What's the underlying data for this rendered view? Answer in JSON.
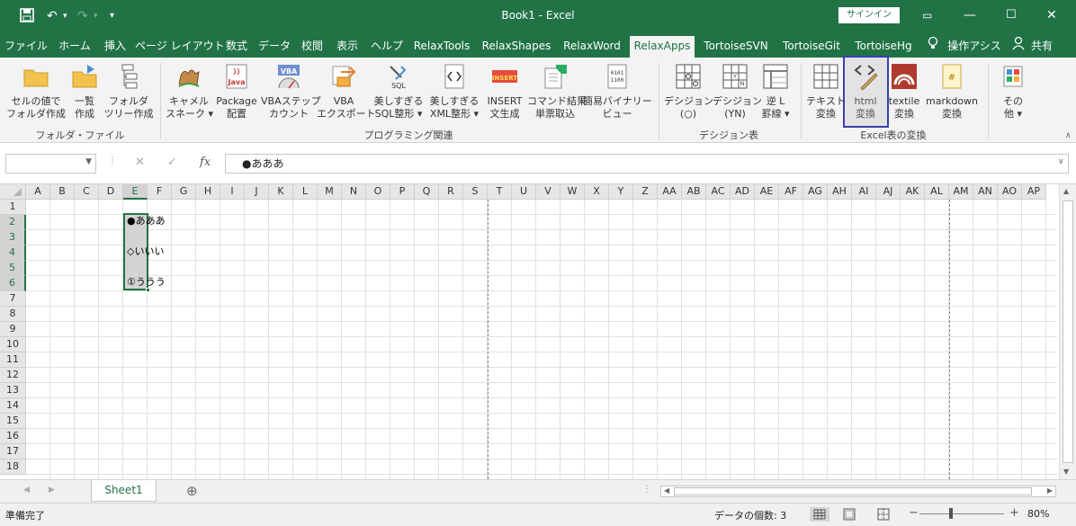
{
  "colors": {
    "brand": "#217346",
    "highlight_box": "#3a3fb0"
  },
  "title": {
    "text": "Book1  -  Excel",
    "signin": "サインイン"
  },
  "tabs": [
    "ファイル",
    "ホーム",
    "挿入",
    "ページ レイアウト",
    "数式",
    "データ",
    "校閲",
    "表示",
    "ヘルプ",
    "RelaxTools",
    "RelaxShapes",
    "RelaxWord",
    "RelaxApps",
    "TortoiseSVN",
    "TortoiseGit",
    "TortoiseHg",
    "操作アシス",
    "共有"
  ],
  "active_tab": "RelaxApps",
  "ribbon": {
    "buttons": [
      "セルの値で\nフォルダ作成",
      "一覧\n作成",
      "フォルダ\nツリー作成",
      "キャメル\nスネーク ▾",
      "Package\n配置",
      "VBAステップ\nカウント",
      "VBA\nエクスポート",
      "美しすぎる\nSQL整形 ▾",
      "美しすぎる\nXML整形 ▾",
      "INSERT\n文生成",
      "コマンド結果\n単票取込",
      "簡易バイナリー\nビュー",
      "デシジョン\n(○)",
      "デシジョン\n(YN)",
      "逆 L\n罫線 ▾",
      "テキスト\n変換",
      "html\n変換",
      "textile\n変換",
      "markdown\n変換",
      "その\n他 ▾"
    ],
    "groups": [
      "フォルダ・ファイル",
      "プログラミング関連",
      "デシジョン表",
      "Excel表の変換"
    ],
    "icon_texts": {
      "java": "Java",
      "vba": "VBA",
      "sql": "SQL",
      "insert": "INSERT",
      "binary": "0101\n1100",
      "html": "<>"
    }
  },
  "formula_bar": {
    "name_box": "",
    "cancel": "✕",
    "enter": "✓",
    "fx": "fx",
    "value": "●あああ"
  },
  "columns": [
    "A",
    "B",
    "C",
    "D",
    "E",
    "F",
    "G",
    "H",
    "I",
    "J",
    "K",
    "L",
    "M",
    "N",
    "O",
    "P",
    "Q",
    "R",
    "S",
    "T",
    "U",
    "V",
    "W",
    "X",
    "Y",
    "Z",
    "AA",
    "AB",
    "AC",
    "AD",
    "AE",
    "AF",
    "AG",
    "AH",
    "AI",
    "AJ",
    "AK",
    "AL",
    "AM",
    "AN",
    "AO",
    "AP",
    "A"
  ],
  "rows": [
    "1",
    "2",
    "3",
    "4",
    "5",
    "6",
    "7",
    "8",
    "9",
    "10",
    "11",
    "12",
    "13",
    "14",
    "15",
    "16",
    "17",
    "18"
  ],
  "cells": {
    "E2": "●あああ",
    "E4": "◇いいい",
    "E6": "①ううう"
  },
  "sheet": {
    "name": "Sheet1",
    "add": "⊕"
  },
  "status": {
    "ready": "準備完了",
    "count": "データの個数: 3",
    "minus": "−",
    "plus": "+",
    "zoom": "80%"
  }
}
